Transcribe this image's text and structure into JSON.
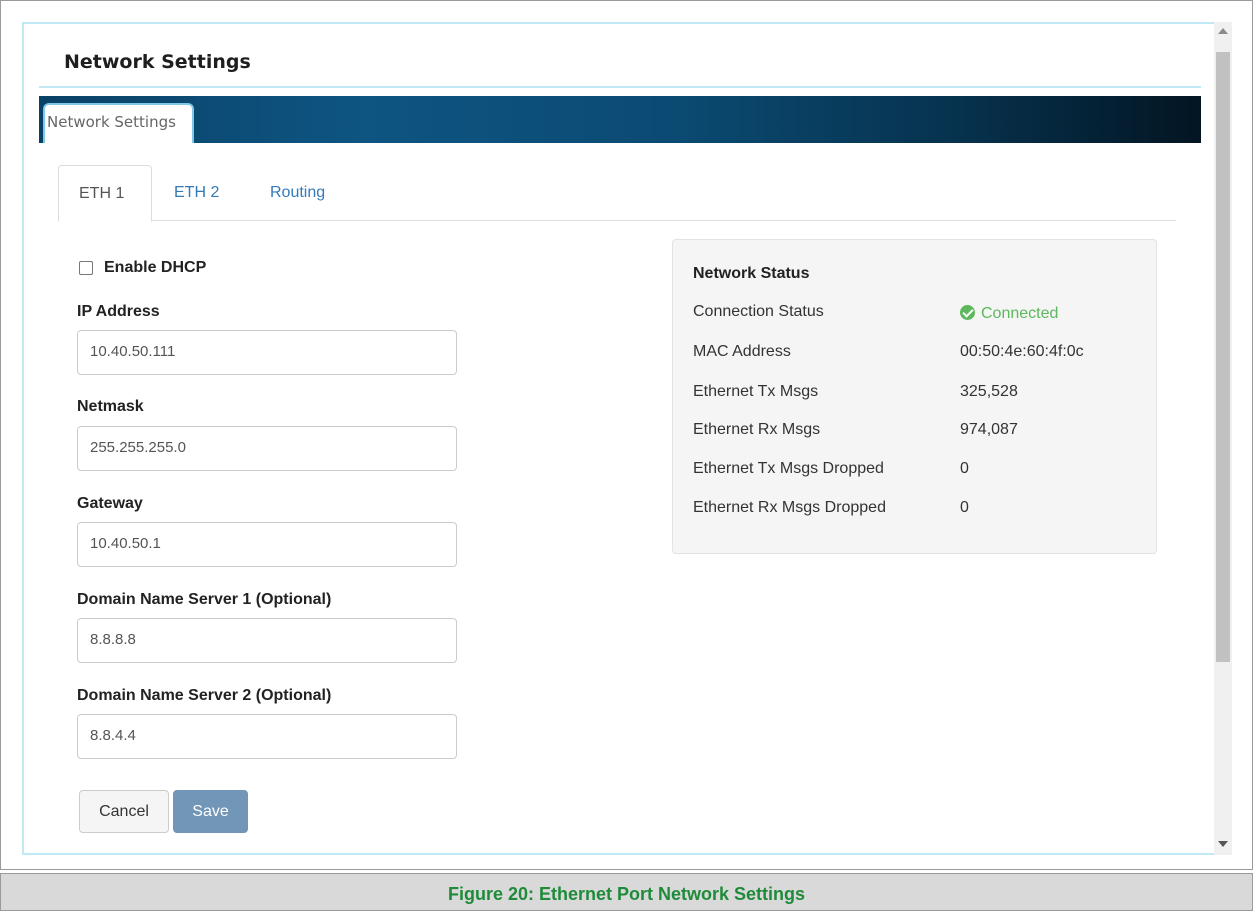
{
  "header": {
    "title": "Network Settings"
  },
  "banner": {
    "tab_label": "Network Settings"
  },
  "tabs": [
    {
      "label": "ETH 1",
      "active": true
    },
    {
      "label": "ETH 2",
      "active": false
    },
    {
      "label": "Routing",
      "active": false
    }
  ],
  "form": {
    "dhcp": {
      "label": "Enable DHCP",
      "checked": false
    },
    "ip": {
      "label": "IP Address",
      "value": "10.40.50.111"
    },
    "netmask": {
      "label": "Netmask",
      "value": "255.255.255.0"
    },
    "gateway": {
      "label": "Gateway",
      "value": "10.40.50.1"
    },
    "dns1": {
      "label": "Domain Name Server 1 (Optional)",
      "value": "8.8.8.8"
    },
    "dns2": {
      "label": "Domain Name Server 2 (Optional)",
      "value": "8.8.4.4"
    },
    "cancel_label": "Cancel",
    "save_label": "Save"
  },
  "status": {
    "heading": "Network Status",
    "rows": [
      {
        "label": "Connection Status",
        "value": "Connected"
      },
      {
        "label": "MAC Address",
        "value": "00:50:4e:60:4f:0c"
      },
      {
        "label": "Ethernet Tx Msgs",
        "value": "325,528"
      },
      {
        "label": "Ethernet Rx Msgs",
        "value": "974,087"
      },
      {
        "label": "Ethernet Tx Msgs Dropped",
        "value": "0"
      },
      {
        "label": "Ethernet Rx Msgs Dropped",
        "value": "0"
      }
    ]
  },
  "colors": {
    "connected": "#5cb85c",
    "link": "#337ab7",
    "save_button": "#7196b8",
    "caption_text": "#1f8b3a"
  },
  "caption": "Figure 20: Ethernet Port Network Settings"
}
